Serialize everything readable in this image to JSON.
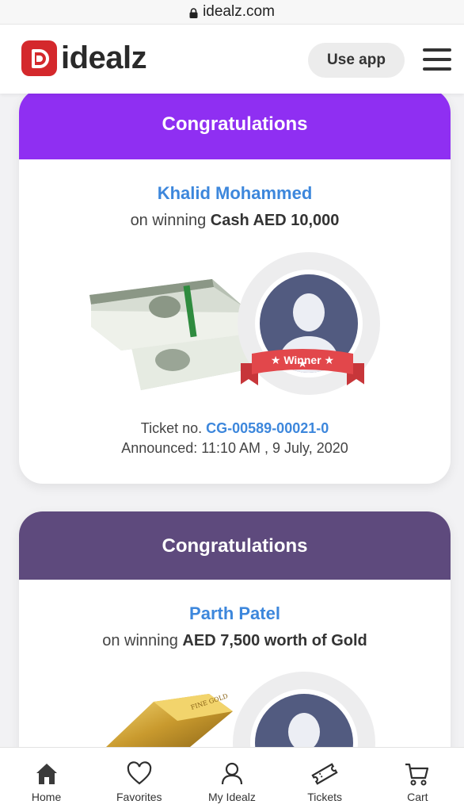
{
  "browser": {
    "url": "idealz.com",
    "lock_icon": "lock-icon"
  },
  "header": {
    "logo_text": "idealz",
    "use_app_label": "Use app",
    "menu_icon": "hamburger-menu-icon",
    "brand_color": "#d4282c"
  },
  "cards": [
    {
      "heading": "Congratulations",
      "heading_color": "#8f2ff2",
      "winner_name": "Khalid Mohammed",
      "prize_prefix": "on winning",
      "prize": "Cash AED 10,000",
      "ribbon_label": "Winner",
      "ticket_prefix": "Ticket no.",
      "ticket_number": "CG-00589-00021-0",
      "announced": "Announced: 11:10 AM , 9 July, 2020"
    },
    {
      "heading": "Congratulations",
      "heading_color": "#5e4a7d",
      "winner_name": "Parth Patel",
      "prize_prefix": "on winning",
      "prize": "AED 7,500 worth of Gold",
      "gold_text": "FINE GOLD"
    }
  ],
  "bottom_nav": [
    {
      "label": "Home",
      "icon": "home-icon"
    },
    {
      "label": "Favorites",
      "icon": "heart-icon"
    },
    {
      "label": "My Idealz",
      "icon": "user-icon"
    },
    {
      "label": "Tickets",
      "icon": "ticket-icon"
    },
    {
      "label": "Cart",
      "icon": "cart-icon"
    }
  ],
  "colors": {
    "accent_blue": "#3d87dc",
    "ribbon_red": "#e2474b",
    "avatar_bg": "#525b80"
  }
}
